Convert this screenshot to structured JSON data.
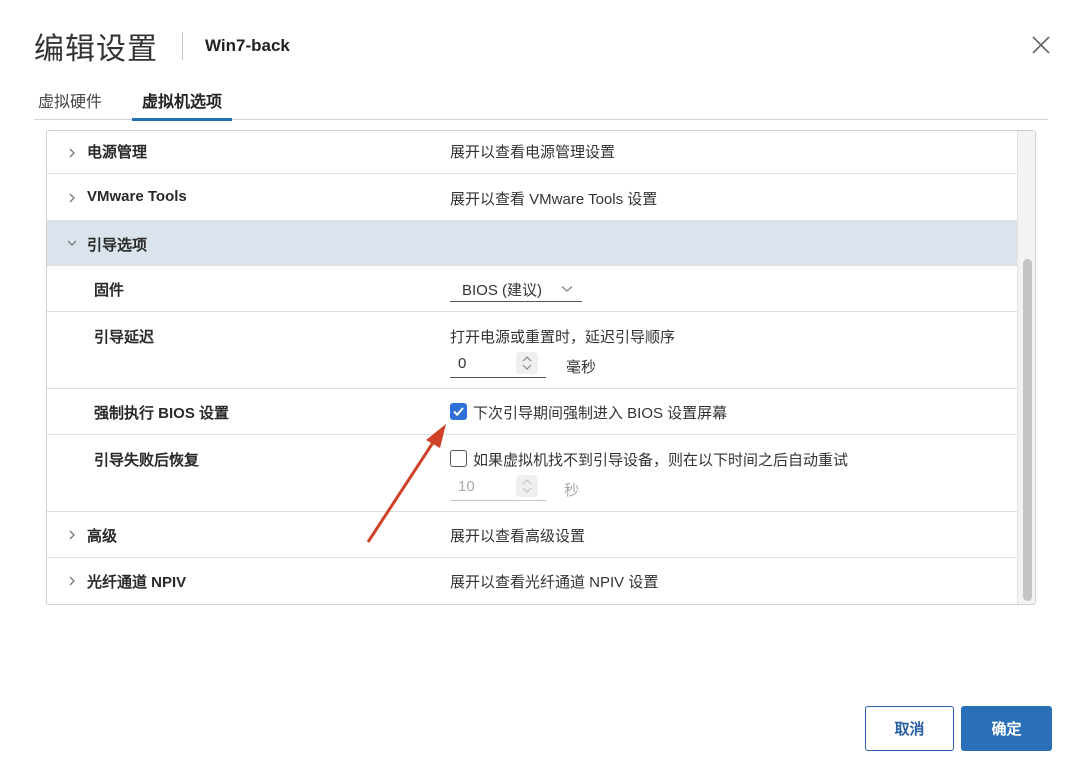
{
  "header": {
    "title": "编辑设置",
    "vm_name": "Win7-back"
  },
  "tabs": [
    {
      "label": "虚拟硬件",
      "active": false
    },
    {
      "label": "虚拟机选项",
      "active": true
    }
  ],
  "sections": {
    "power": {
      "label": "电源管理",
      "desc": "展开以查看电源管理设置"
    },
    "tools": {
      "label": "VMware Tools",
      "desc": "展开以查看 VMware Tools 设置"
    },
    "boot": {
      "label": "引导选项"
    },
    "advanced": {
      "label": "高级",
      "desc": "展开以查看高级设置"
    },
    "npiv": {
      "label": "光纤通道 NPIV",
      "desc": "展开以查看光纤通道 NPIV 设置"
    }
  },
  "boot": {
    "firmware": {
      "label": "固件",
      "value": "BIOS (建议)"
    },
    "delay": {
      "label": "引导延迟",
      "desc": "打开电源或重置时，延迟引导顺序",
      "value": "0",
      "unit": "毫秒"
    },
    "force_bios": {
      "label": "强制执行 BIOS 设置",
      "checkbox_label": "下次引导期间强制进入 BIOS 设置屏幕",
      "checked": true
    },
    "failed_recovery": {
      "label": "引导失败后恢复",
      "checkbox_label": "如果虚拟机找不到引导设备，则在以下时间之后自动重试",
      "checked": false,
      "value": "10",
      "unit": "秒"
    }
  },
  "buttons": {
    "cancel": "取消",
    "ok": "确定"
  },
  "colors": {
    "accent": "#2a6fb7",
    "checkbox": "#2f6fd8",
    "expanded_row": "#dbe4ec",
    "annotation_arrow": "#d0412a"
  }
}
